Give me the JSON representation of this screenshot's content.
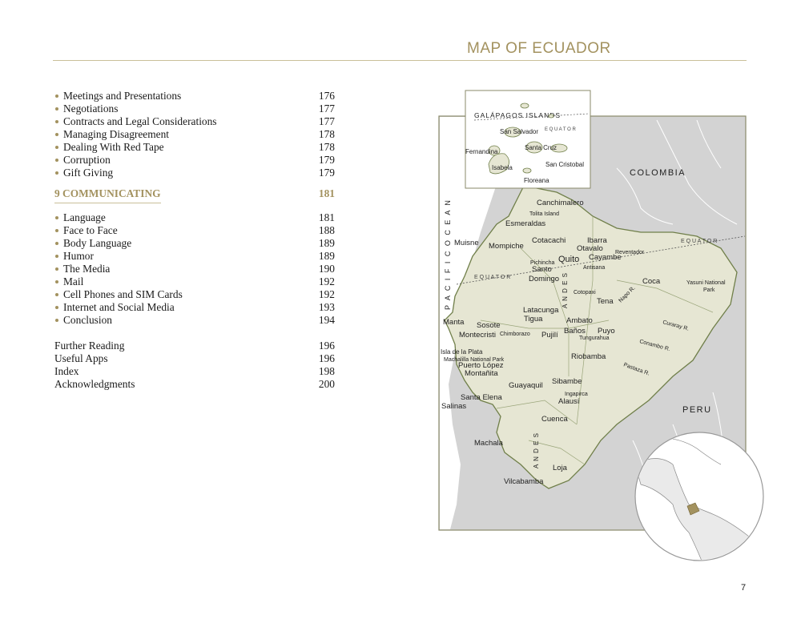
{
  "header": {
    "title": "MAP OF ECUADOR"
  },
  "toc": {
    "group1": [
      {
        "label": "Meetings and Presentations",
        "page": "176"
      },
      {
        "label": "Negotiations",
        "page": "177"
      },
      {
        "label": "Contracts and Legal Considerations",
        "page": "177"
      },
      {
        "label": "Managing Disagreement",
        "page": "178"
      },
      {
        "label": "Dealing With Red Tape",
        "page": "178"
      },
      {
        "label": "Corruption",
        "page": "179"
      },
      {
        "label": "Gift Giving",
        "page": "179"
      }
    ],
    "chapter": {
      "label": "9  COMMUNICATING",
      "page": "181"
    },
    "group2": [
      {
        "label": "Language",
        "page": "181"
      },
      {
        "label": "Face to Face",
        "page": "188"
      },
      {
        "label": "Body Language",
        "page": "189"
      },
      {
        "label": "Humor",
        "page": "189"
      },
      {
        "label": "The Media",
        "page": "190"
      },
      {
        "label": "Mail",
        "page": "192"
      },
      {
        "label": "Cell Phones and SIM Cards",
        "page": "192"
      },
      {
        "label": "Internet and Social Media",
        "page": "193"
      },
      {
        "label": "Conclusion",
        "page": "194"
      }
    ],
    "back": [
      {
        "label": "Further Reading",
        "page": "196"
      },
      {
        "label": "Useful Apps",
        "page": "196"
      },
      {
        "label": "Index",
        "page": "198"
      },
      {
        "label": "Acknowledgments",
        "page": "200"
      }
    ]
  },
  "map": {
    "inset_title": "GALÁPAGOS ISLANDS",
    "equator": "E Q U A T O R",
    "ocean": "P A C I F I C   O C E A N",
    "andes": "A N D E S",
    "countries": {
      "colombia": "COLOMBIA",
      "peru": "PERU"
    },
    "islands": [
      "San Salvador",
      "Santa Cruz",
      "Fernandina",
      "Isabela",
      "San Cristobal",
      "Floreana"
    ],
    "places": [
      "Canchimalero",
      "Tolita Island",
      "Esmeraldas",
      "Muisne",
      "Mompiche",
      "Cotacachi",
      "Ibarra",
      "Otavalo",
      "Reventador",
      "Pichincha",
      "Quito",
      "Cayambe",
      "Antisana",
      "Santo",
      "Domingo",
      "Coca",
      "Yasuni National",
      "Park",
      "Napo R.",
      "Cotopaxi",
      "Tena",
      "Latacunga",
      "Tigua",
      "Manta",
      "Sosote",
      "Ambato",
      "Montecristi",
      "Chimborazo",
      "Pujilí",
      "Baños",
      "Puyo",
      "Tungurahua",
      "Curaray R.",
      "Conambo R.",
      "Isla de la Plata",
      "Machalilla National Park",
      "Puerto López",
      "Riobamba",
      "Montañita",
      "Pastaza R.",
      "Sibambe",
      "Guayaquil",
      "Ingapirca",
      "Alausí",
      "Santa Elena",
      "Salinas",
      "Cuenca",
      "Machala",
      "Loja",
      "Vilcabamba"
    ]
  },
  "footer": {
    "page_number": "7"
  }
}
